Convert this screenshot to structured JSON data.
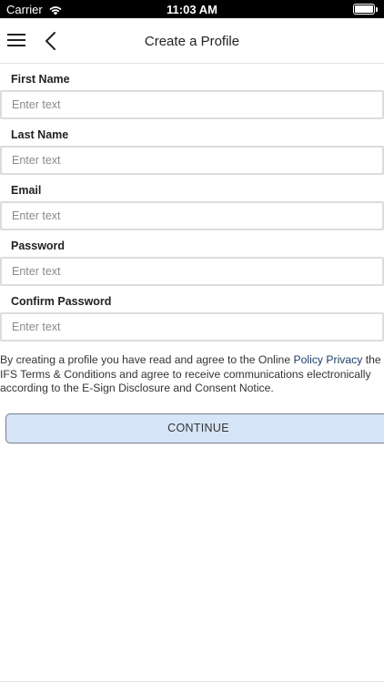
{
  "status_bar": {
    "carrier": "Carrier",
    "time": "11:03 AM",
    "icons": [
      "wifi-icon",
      "battery-icon"
    ]
  },
  "nav": {
    "title": "Create a Profile",
    "icons": [
      "hamburger-menu-icon",
      "back-chevron-icon"
    ]
  },
  "form": {
    "fields": [
      {
        "label": "First Name",
        "placeholder": "Enter text",
        "value": ""
      },
      {
        "label": "Last Name",
        "placeholder": "Enter text",
        "value": ""
      },
      {
        "label": "Email",
        "placeholder": "Enter text",
        "value": ""
      },
      {
        "label": "Password",
        "placeholder": "Enter text",
        "value": ""
      },
      {
        "label": "Confirm Password",
        "placeholder": "Enter text",
        "value": ""
      }
    ]
  },
  "consent": {
    "text_before": "By creating a profile you have read and agree to the Online ",
    "policy_link": "Policy Privacy",
    "text_after": " the IFS Terms & Conditions and agree to receive communications electronically according to the E-Sign Disclosure and Consent Notice."
  },
  "continue_button": {
    "label": "CONTINUE"
  },
  "colors": {
    "link": "#1c3d6b",
    "button_bg": "#d6e5f7",
    "input_border": "#dcdcdc",
    "status_bar_bg": "#000000"
  }
}
